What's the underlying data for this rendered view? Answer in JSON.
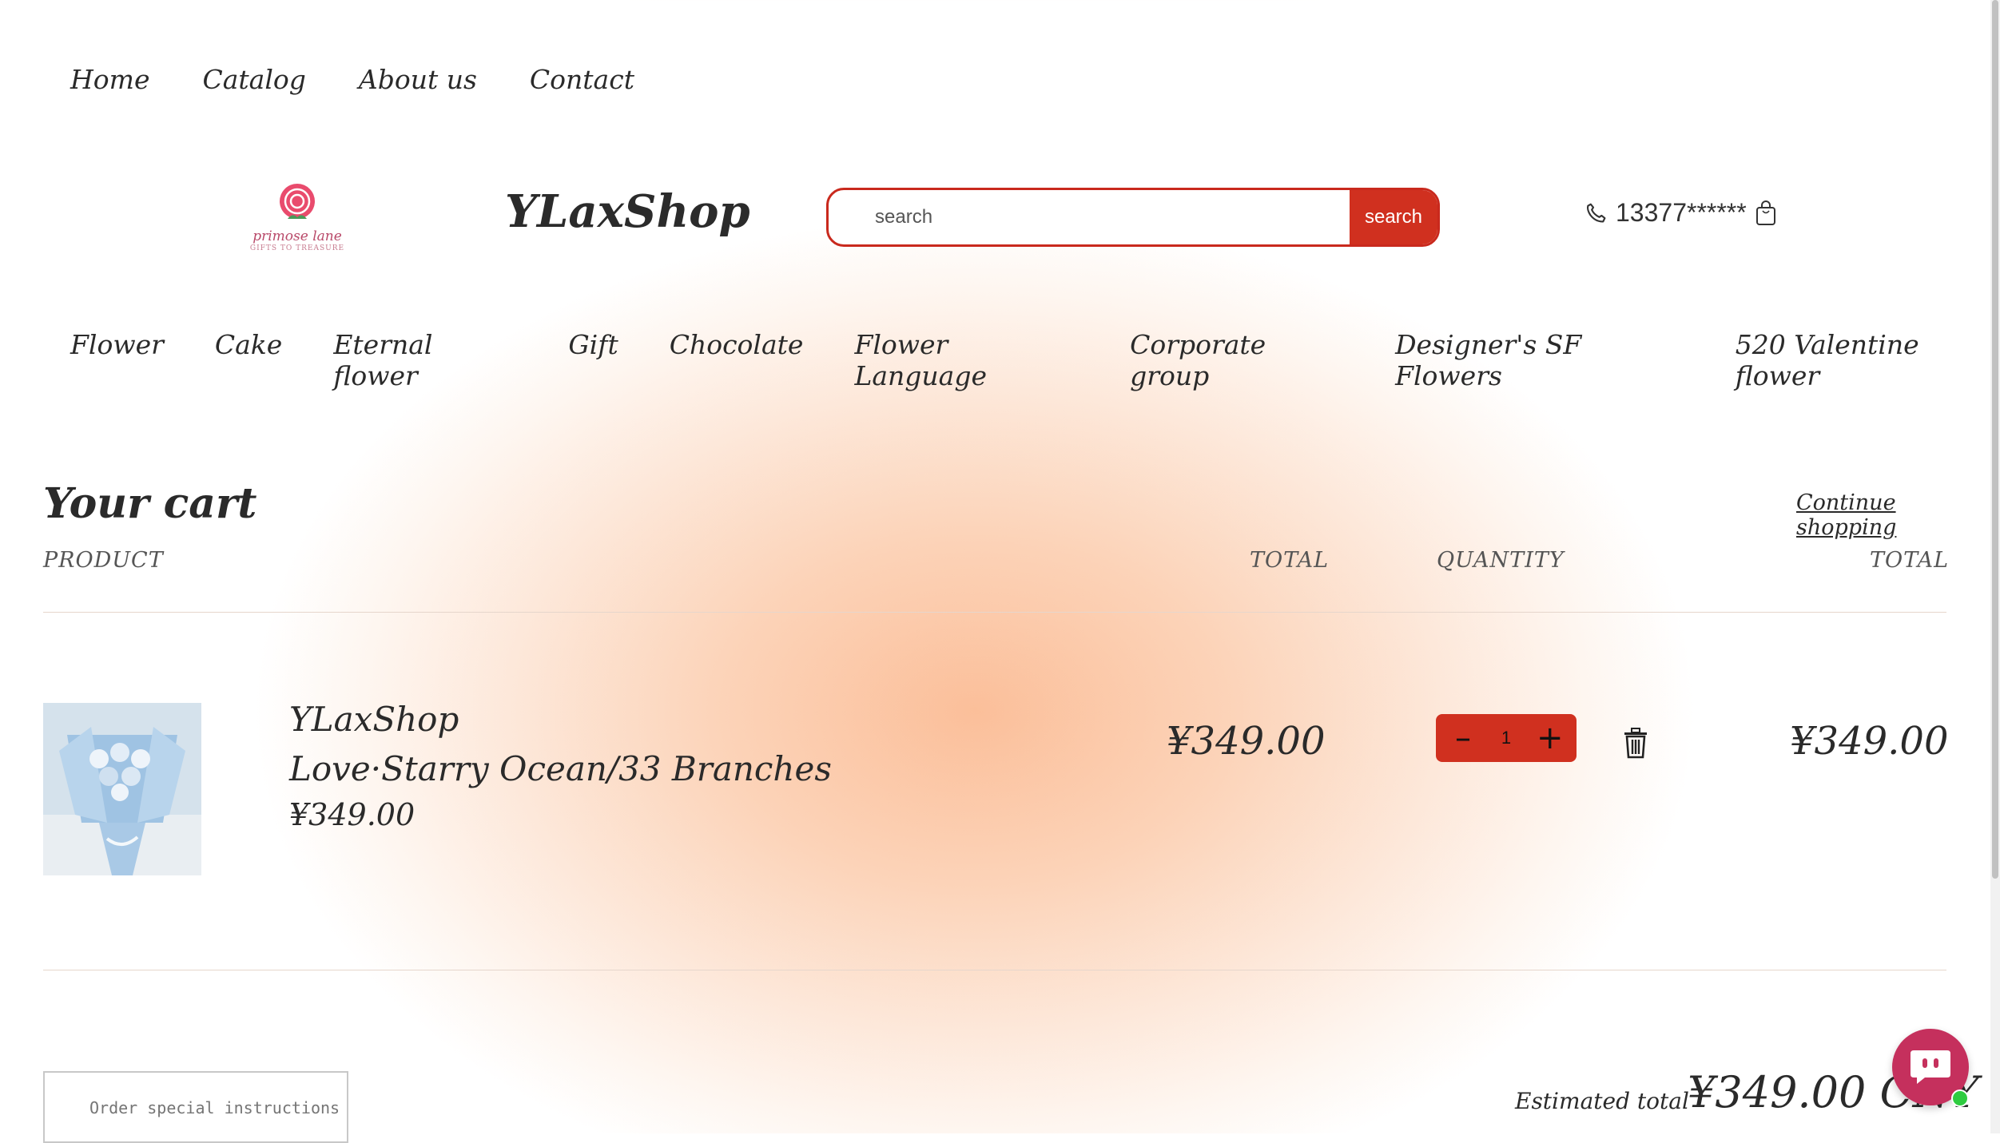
{
  "top_nav": [
    "Home",
    "Catalog",
    "About us",
    "Contact"
  ],
  "logo": {
    "text": "primose lane",
    "sub": "GIFTS TO TREASURE"
  },
  "brand": "YLaxShop",
  "search": {
    "placeholder": "search",
    "button_label": "search"
  },
  "phone": "13377******",
  "categories": [
    "Flower",
    "Cake",
    "Eternal flower",
    "Gift",
    "Chocolate",
    "Flower Language",
    "Corporate group",
    "Designer's SF Flowers",
    "520 Valentine flower"
  ],
  "cart": {
    "title": "Your cart",
    "continue_label": "Continue shopping",
    "headers": {
      "product": "PRODUCT",
      "price": "TOTAL",
      "quantity": "QUANTITY",
      "total": "TOTAL"
    },
    "items": [
      {
        "vendor": "YLaxShop",
        "name": "Love·Starry Ocean/33 Branches",
        "unit_price": "¥349.00",
        "price": "¥349.00",
        "quantity": "1",
        "line_total": "¥349.00"
      }
    ],
    "notes_placeholder": "Order special instructions",
    "estimated_label": "Estimated total",
    "estimated_value": "¥349.00 CNY"
  },
  "colors": {
    "accent": "#d0301f",
    "chat": "#c5305d",
    "online": "#2ecc40"
  },
  "icons": [
    "phone-icon",
    "bag-icon",
    "minus-icon",
    "plus-icon",
    "trash-icon",
    "chat-icon"
  ]
}
